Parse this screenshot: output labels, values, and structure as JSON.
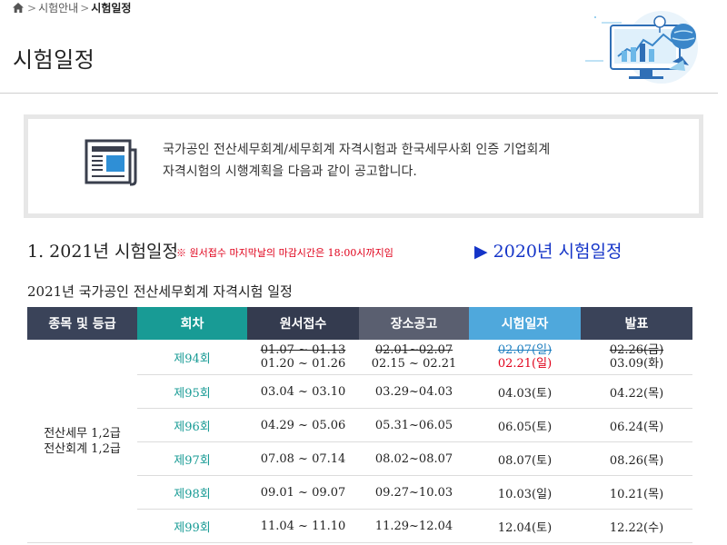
{
  "breadcrumb": {
    "items": [
      "시험안내",
      "시험일정"
    ],
    "separator": ">"
  },
  "page_title": "시험일정",
  "notice": {
    "line1": "국가공인 전산세무회계/세무회계 자격시험과 한국세무사회 인증 기업회계",
    "line2": "자격시험의 시행계획을 다음과 같이 공고합니다."
  },
  "section": {
    "title": "1. 2021년 시험일정",
    "note": "※ 원서접수 마지막날의 마감시간은 18:00시까지임",
    "link": "▶ 2020년 시험일정"
  },
  "subtitle": "2021년 국가공인 전산세무회계 자격시험 일정",
  "table": {
    "headers": [
      "종목 및 등급",
      "회차",
      "원서접수",
      "장소공고",
      "시험일자",
      "발표"
    ],
    "grade_line1": "전산세무 1,2급",
    "grade_line2": "전산회계 1,2급",
    "first_row": {
      "round": "제94회",
      "apply_old": "01.07 ~ 01.13",
      "apply_new": "01.20 ~ 01.26",
      "venue_old": "02.01~02.07",
      "venue_new": "02.15 ~ 02.21",
      "exam_old": "02.07(일)",
      "exam_new": "02.21(일)",
      "result_old": "02.26(금)",
      "result_new": "03.09(화)"
    },
    "rows": [
      {
        "round": "제95회",
        "apply": "03.04 ~ 03.10",
        "venue": "03.29~04.03",
        "exam": "04.03(토)",
        "result": "04.22(목)"
      },
      {
        "round": "제96회",
        "apply": "04.29 ~ 05.06",
        "venue": "05.31~06.05",
        "exam": "06.05(토)",
        "result": "06.24(목)"
      },
      {
        "round": "제97회",
        "apply": "07.08 ~ 07.14",
        "venue": "08.02~08.07",
        "exam": "08.07(토)",
        "result": "08.26(목)"
      },
      {
        "round": "제98회",
        "apply": "09.01 ~ 09.07",
        "venue": "09.27~10.03",
        "exam": "10.03(일)",
        "result": "10.21(목)"
      },
      {
        "round": "제99회",
        "apply": "11.04 ~ 11.10",
        "venue": "11.29~12.04",
        "exam": "12.04(토)",
        "result": "12.22(수)"
      }
    ]
  },
  "colors": {
    "round_teal": "#189b95",
    "exam_blue": "#1e7fc0",
    "sunday_red": "#e0001a",
    "link_blue": "#1434c8"
  },
  "icons": {
    "home": "home-icon",
    "notice": "newspaper-icon",
    "hero": "computer-illustration"
  }
}
